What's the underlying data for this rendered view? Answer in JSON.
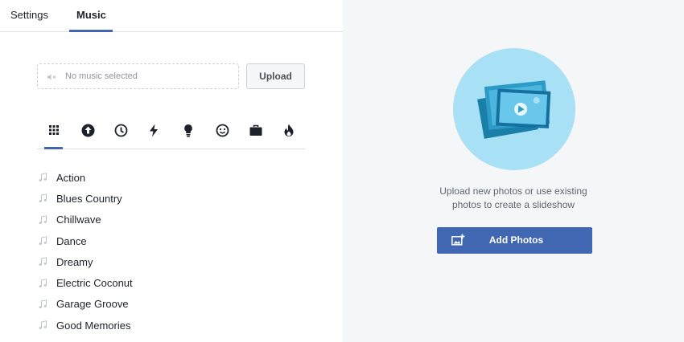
{
  "tabs": [
    {
      "label": "Settings",
      "active": false
    },
    {
      "label": "Music",
      "active": true
    }
  ],
  "music": {
    "placeholder": "No music selected",
    "upload_label": "Upload"
  },
  "categories": [
    {
      "icon": "grid-icon",
      "active": true
    },
    {
      "icon": "arrow-up-circle-icon",
      "active": false
    },
    {
      "icon": "clock-icon",
      "active": false
    },
    {
      "icon": "lightning-icon",
      "active": false
    },
    {
      "icon": "lightbulb-icon",
      "active": false
    },
    {
      "icon": "smiley-icon",
      "active": false
    },
    {
      "icon": "briefcase-icon",
      "active": false
    },
    {
      "icon": "flame-icon",
      "active": false
    }
  ],
  "songs": [
    "Action",
    "Blues Country",
    "Chillwave",
    "Dance",
    "Dreamy",
    "Electric Coconut",
    "Garage Groove",
    "Good Memories"
  ],
  "slideshow": {
    "hint_line1": "Upload new photos or use existing",
    "hint_line2": "photos to create a slideshow",
    "add_photos_label": "Add Photos"
  },
  "colors": {
    "accent": "#4267b2",
    "hero_bg": "#a8e0f5",
    "panel_bg": "#f5f6f7"
  }
}
